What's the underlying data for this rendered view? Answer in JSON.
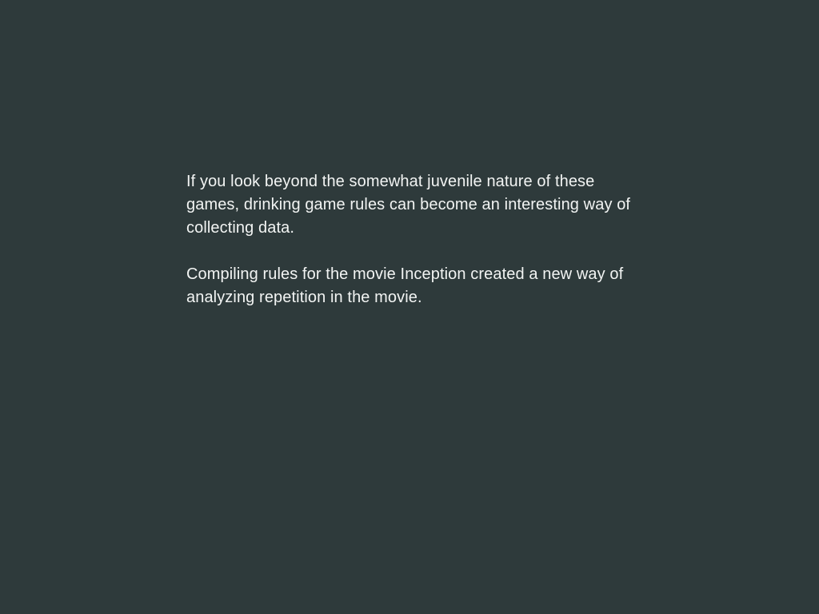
{
  "slide": {
    "paragraphs": [
      "If you look beyond the somewhat juvenile nature of these games, drinking game rules can become an interesting way of collecting data.",
      "Compiling rules for the movie Inception created a new way of analyzing repetition in the movie."
    ]
  }
}
